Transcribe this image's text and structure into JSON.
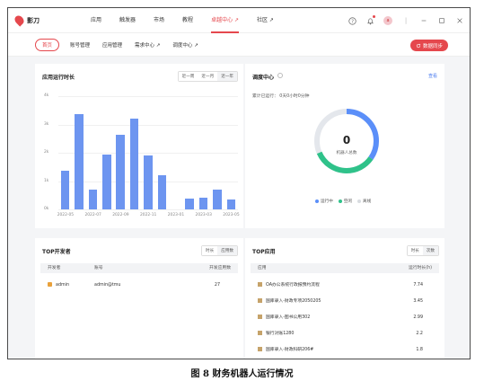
{
  "app": {
    "name": "影刀"
  },
  "topnav": [
    {
      "label": "应用"
    },
    {
      "label": "触发器"
    },
    {
      "label": "市场"
    },
    {
      "label": "教程"
    },
    {
      "label": "卓越中心 ↗",
      "active": true
    },
    {
      "label": "社区 ↗"
    }
  ],
  "user": {
    "avatar": "a"
  },
  "subnav": [
    {
      "label": "首页"
    },
    {
      "label": "账号管理"
    },
    {
      "label": "应用管理"
    },
    {
      "label": "需求中心 ↗"
    },
    {
      "label": "调度中心 ↗"
    }
  ],
  "sync_button": "数据同步",
  "runtime": {
    "title": "应用运行时长",
    "ranges": [
      "近一周",
      "近一月",
      "近一年"
    ],
    "active_range": "近一年"
  },
  "chart_data": {
    "type": "bar",
    "title": "应用运行时长",
    "y_ticks": [
      "4k",
      "3k",
      "2k",
      "1k",
      "0k"
    ],
    "ylim": [
      0,
      4000
    ],
    "x_tick_labels": [
      "2022-05",
      "2022-07",
      "2022-09",
      "2022-11",
      "2023-01",
      "2023-03",
      "2023-05"
    ],
    "categories": [
      "2022-05",
      "2022-06",
      "2022-07",
      "2022-08",
      "2022-09",
      "2022-10",
      "2022-11",
      "2022-12",
      "2023-01",
      "2023-02",
      "2023-03",
      "2023-04",
      "2023-05"
    ],
    "values": [
      1350,
      3350,
      700,
      1950,
      2650,
      3200,
      1900,
      1200,
      0,
      380,
      400,
      700,
      350
    ]
  },
  "schedule": {
    "title": "调度中心",
    "view_label": "查看",
    "accumulated": "累计已运行： 0天0小时0分钟",
    "center_value": "0",
    "center_label": "机器人总数",
    "legend": [
      {
        "label": "运行中",
        "color": "#5b8ff9"
      },
      {
        "label": "空闲",
        "color": "#2fc28a"
      },
      {
        "label": "离线",
        "color": "#e4e7ec"
      }
    ]
  },
  "top_dev": {
    "title": "TOP开发者",
    "tabs": [
      "时长",
      "应用数"
    ],
    "columns": [
      "开发者",
      "账号",
      "开发应用数"
    ],
    "rows": [
      {
        "name": "admin",
        "account": "admin@tmu",
        "count": "27"
      }
    ]
  },
  "top_app": {
    "title": "TOP应用",
    "tabs": [
      "时长",
      "次数"
    ],
    "columns": [
      "应用",
      "运行时长(h)"
    ],
    "rows": [
      {
        "name": "OA办公系统行政报预约流程",
        "hours": "7.74"
      },
      {
        "name": "国库录入-财政专项2050205",
        "hours": "3.45"
      },
      {
        "name": "国库录入-图书公用302",
        "hours": "2.99"
      },
      {
        "name": "银行对账1280",
        "hours": "2.2"
      },
      {
        "name": "国库录入-财政科研206#",
        "hours": "1.8"
      }
    ]
  },
  "caption": "图 8 财务机器人运行情况"
}
